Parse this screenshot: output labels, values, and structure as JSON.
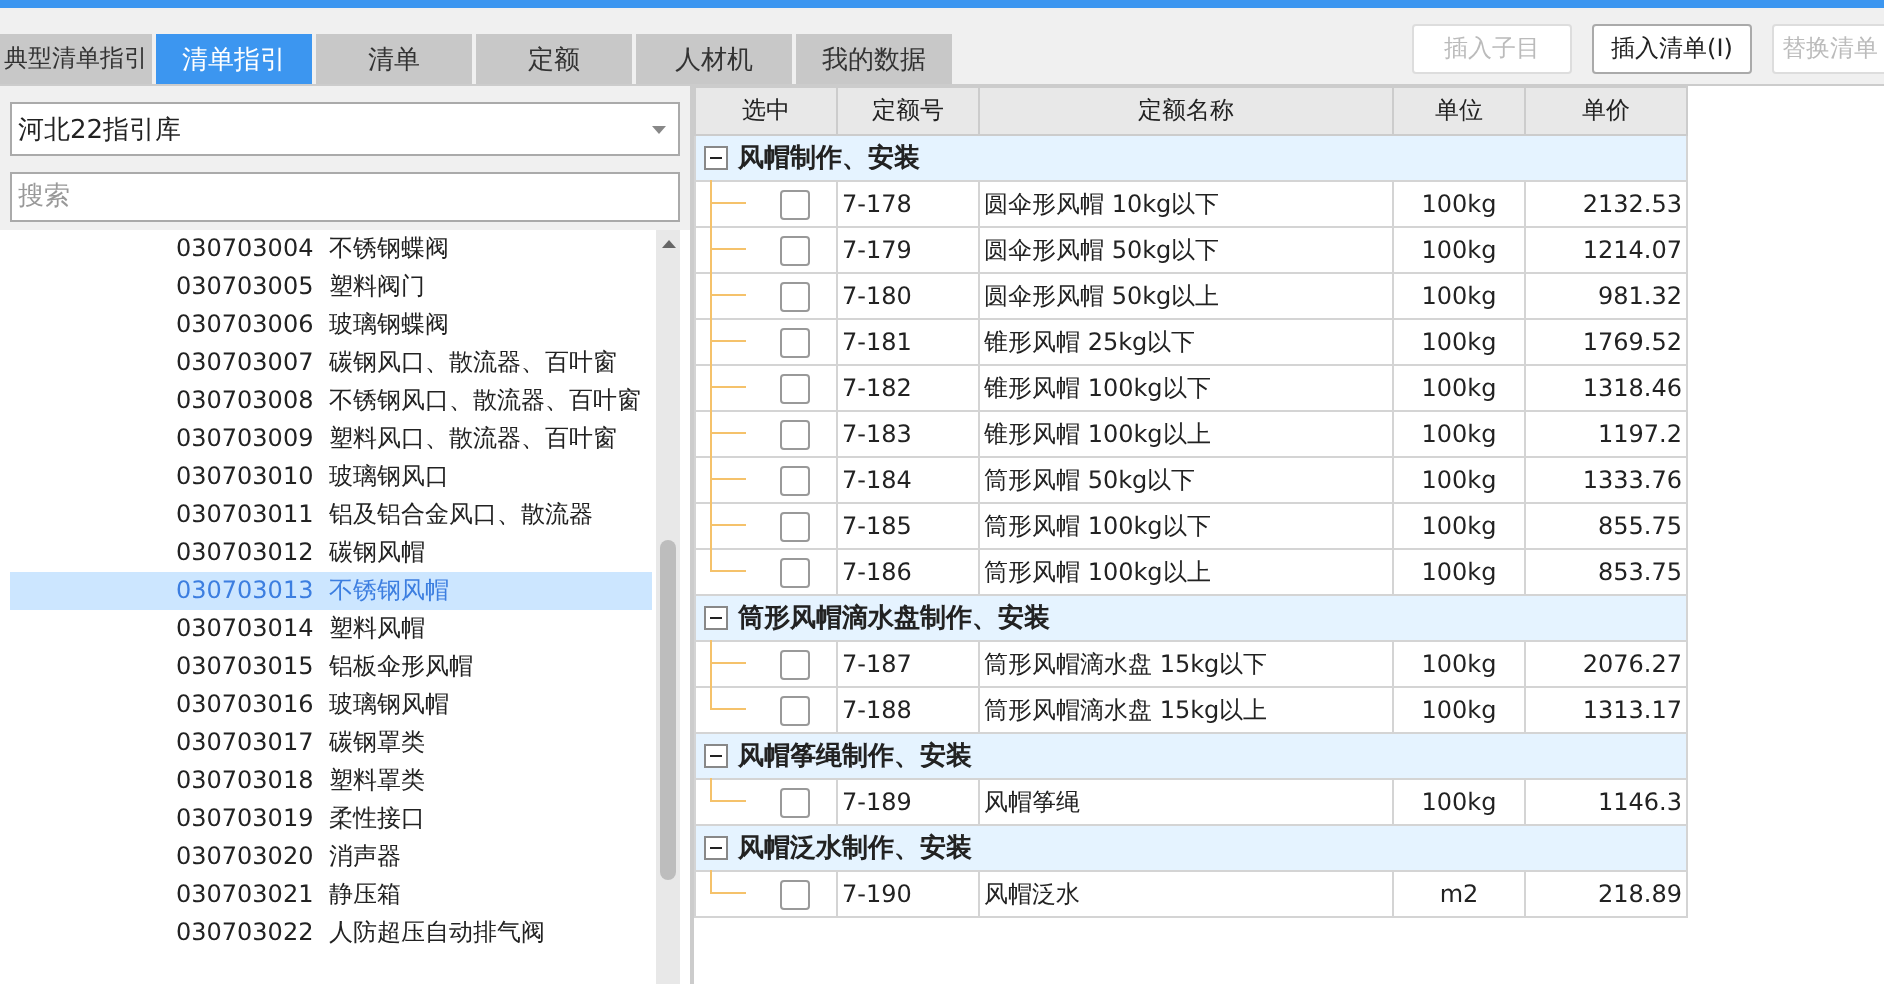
{
  "tabs": [
    {
      "label": "典型清单指引",
      "selected": false
    },
    {
      "label": "清单指引",
      "selected": true
    },
    {
      "label": "清单",
      "selected": false
    },
    {
      "label": "定额",
      "selected": false
    },
    {
      "label": "人材机",
      "selected": false
    },
    {
      "label": "我的数据",
      "selected": false
    }
  ],
  "buttons": [
    {
      "label": "插入子目",
      "disabled": true
    },
    {
      "label": "插入清单(I)",
      "disabled": false
    },
    {
      "label": "替换清单",
      "disabled": true
    }
  ],
  "library_select": {
    "value": "河北22指引库"
  },
  "search": {
    "placeholder": "搜索"
  },
  "list": [
    {
      "code": "030703004",
      "name": "不锈钢蝶阀",
      "selected": false
    },
    {
      "code": "030703005",
      "name": "塑料阀门",
      "selected": false
    },
    {
      "code": "030703006",
      "name": "玻璃钢蝶阀",
      "selected": false
    },
    {
      "code": "030703007",
      "name": "碳钢风口、散流器、百叶窗",
      "selected": false
    },
    {
      "code": "030703008",
      "name": "不锈钢风口、散流器、百叶窗",
      "selected": false
    },
    {
      "code": "030703009",
      "name": "塑料风口、散流器、百叶窗",
      "selected": false
    },
    {
      "code": "030703010",
      "name": "玻璃钢风口",
      "selected": false
    },
    {
      "code": "030703011",
      "name": "铝及铝合金风口、散流器",
      "selected": false
    },
    {
      "code": "030703012",
      "name": "碳钢风帽",
      "selected": false
    },
    {
      "code": "030703013",
      "name": "不锈钢风帽",
      "selected": true
    },
    {
      "code": "030703014",
      "name": "塑料风帽",
      "selected": false
    },
    {
      "code": "030703015",
      "name": "铝板伞形风帽",
      "selected": false
    },
    {
      "code": "030703016",
      "name": "玻璃钢风帽",
      "selected": false
    },
    {
      "code": "030703017",
      "name": "碳钢罩类",
      "selected": false
    },
    {
      "code": "030703018",
      "name": "塑料罩类",
      "selected": false
    },
    {
      "code": "030703019",
      "name": "柔性接口",
      "selected": false
    },
    {
      "code": "030703020",
      "name": "消声器",
      "selected": false
    },
    {
      "code": "030703021",
      "name": "静压箱",
      "selected": false
    },
    {
      "code": "030703022",
      "name": "人防超压自动排气阀",
      "selected": false
    }
  ],
  "table": {
    "columns": [
      "选中",
      "定额号",
      "定额名称",
      "单位",
      "单价"
    ],
    "groups": [
      {
        "title": "风帽制作、安装",
        "expanded": true,
        "rows": [
          {
            "checked": false,
            "code": "7-178",
            "name": "圆伞形风帽 10kg以下",
            "unit": "100kg",
            "price": "2132.53"
          },
          {
            "checked": false,
            "code": "7-179",
            "name": "圆伞形风帽 50kg以下",
            "unit": "100kg",
            "price": "1214.07"
          },
          {
            "checked": false,
            "code": "7-180",
            "name": "圆伞形风帽 50kg以上",
            "unit": "100kg",
            "price": "981.32"
          },
          {
            "checked": false,
            "code": "7-181",
            "name": "锥形风帽 25kg以下",
            "unit": "100kg",
            "price": "1769.52"
          },
          {
            "checked": false,
            "code": "7-182",
            "name": "锥形风帽 100kg以下",
            "unit": "100kg",
            "price": "1318.46"
          },
          {
            "checked": false,
            "code": "7-183",
            "name": "锥形风帽 100kg以上",
            "unit": "100kg",
            "price": "1197.2"
          },
          {
            "checked": false,
            "code": "7-184",
            "name": "筒形风帽 50kg以下",
            "unit": "100kg",
            "price": "1333.76"
          },
          {
            "checked": false,
            "code": "7-185",
            "name": "筒形风帽 100kg以下",
            "unit": "100kg",
            "price": "855.75"
          },
          {
            "checked": false,
            "code": "7-186",
            "name": "筒形风帽 100kg以上",
            "unit": "100kg",
            "price": "853.75"
          }
        ]
      },
      {
        "title": "筒形风帽滴水盘制作、安装",
        "expanded": true,
        "rows": [
          {
            "checked": false,
            "code": "7-187",
            "name": "筒形风帽滴水盘 15kg以下",
            "unit": "100kg",
            "price": "2076.27"
          },
          {
            "checked": false,
            "code": "7-188",
            "name": "筒形风帽滴水盘 15kg以上",
            "unit": "100kg",
            "price": "1313.17"
          }
        ]
      },
      {
        "title": "风帽筝绳制作、安装",
        "expanded": true,
        "rows": [
          {
            "checked": false,
            "code": "7-189",
            "name": "风帽筝绳",
            "unit": "100kg",
            "price": "1146.3"
          }
        ]
      },
      {
        "title": "风帽泛水制作、安装",
        "expanded": true,
        "rows": [
          {
            "checked": false,
            "code": "7-190",
            "name": "风帽泛水",
            "unit": "m2",
            "price": "218.89"
          }
        ]
      }
    ]
  }
}
